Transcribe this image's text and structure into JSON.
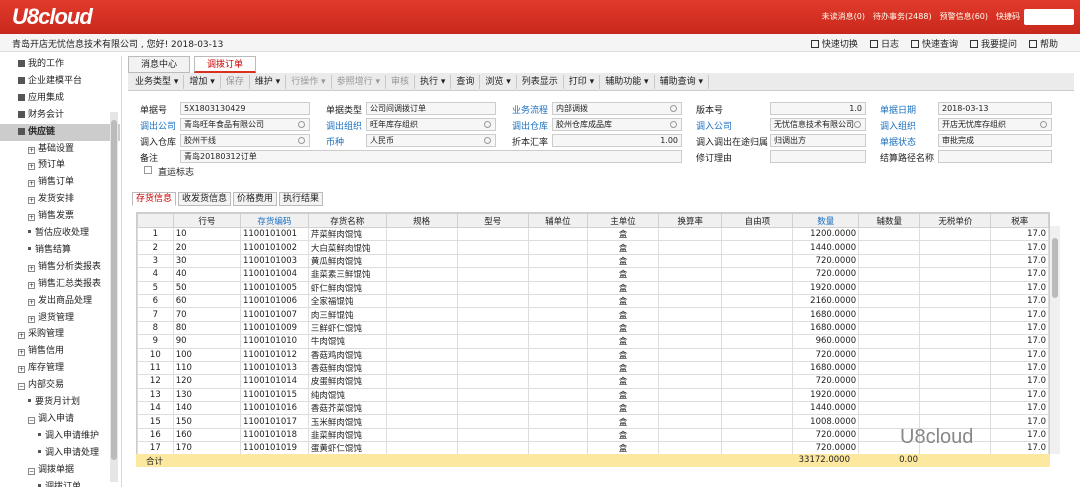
{
  "brand": {
    "logo": "U8cloud",
    "accent": "#d93020"
  },
  "top_links": [
    "未读消息(0)",
    "待办事务(2488)",
    "预警信息(60)",
    "快捷码"
  ],
  "welcome": "青岛开店无忧信息技术有限公司       , 您好! 2018-03-13",
  "quick_links": [
    "快速切换",
    "日志",
    "快速查询",
    "我要提问",
    "帮助"
  ],
  "sidebar": [
    {
      "label": "我的工作",
      "type": "root",
      "indent": 0
    },
    {
      "label": "企业建模平台",
      "type": "root",
      "indent": 0
    },
    {
      "label": "应用集成",
      "type": "root",
      "indent": 0
    },
    {
      "label": "财务会计",
      "type": "root",
      "indent": 0
    },
    {
      "label": "供应链",
      "type": "selected",
      "indent": 0
    },
    {
      "label": "基础设置",
      "type": "plus",
      "indent": 1
    },
    {
      "label": "预订单",
      "type": "plus",
      "indent": 1
    },
    {
      "label": "销售订单",
      "type": "plus",
      "indent": 1
    },
    {
      "label": "发货安排",
      "type": "plus",
      "indent": 1
    },
    {
      "label": "销售发票",
      "type": "plus",
      "indent": 1
    },
    {
      "label": "暂估应收处理",
      "type": "leaf",
      "indent": 1
    },
    {
      "label": "销售结算",
      "type": "leaf",
      "indent": 1
    },
    {
      "label": "销售分析类报表",
      "type": "plus",
      "indent": 1
    },
    {
      "label": "销售汇总类报表",
      "type": "plus",
      "indent": 1
    },
    {
      "label": "发出商品处理",
      "type": "plus",
      "indent": 1
    },
    {
      "label": "退货管理",
      "type": "plus",
      "indent": 1
    },
    {
      "label": "采购管理",
      "type": "plus",
      "indent": 0
    },
    {
      "label": "销售信用",
      "type": "plus",
      "indent": 0
    },
    {
      "label": "库存管理",
      "type": "plus",
      "indent": 0
    },
    {
      "label": "内部交易",
      "type": "minus",
      "indent": 0
    },
    {
      "label": "要货月计划",
      "type": "leaf",
      "indent": 1
    },
    {
      "label": "调入申请",
      "type": "minus",
      "indent": 1
    },
    {
      "label": "调入申请维护",
      "type": "leaf",
      "indent": 2
    },
    {
      "label": "调入申请处理",
      "type": "leaf",
      "indent": 2
    },
    {
      "label": "调拨单据",
      "type": "minus",
      "indent": 1
    },
    {
      "label": "调拨订单",
      "type": "leaf",
      "indent": 2
    }
  ],
  "tabs": [
    "消息中心",
    "调拨订单"
  ],
  "toolbar": [
    {
      "label": "业务类型 ▾",
      "enabled": true
    },
    {
      "label": "增加 ▾",
      "enabled": true
    },
    {
      "label": "保存",
      "enabled": false
    },
    {
      "label": "维护 ▾",
      "enabled": true
    },
    {
      "label": "行操作 ▾",
      "enabled": false
    },
    {
      "label": "参照增行 ▾",
      "enabled": false
    },
    {
      "label": "审核",
      "enabled": false
    },
    {
      "label": "执行 ▾",
      "enabled": true
    },
    {
      "label": "查询",
      "enabled": true
    },
    {
      "label": "浏览 ▾",
      "enabled": true
    },
    {
      "label": "列表显示",
      "enabled": true
    },
    {
      "label": "打印 ▾",
      "enabled": true
    },
    {
      "label": "辅助功能 ▾",
      "enabled": true
    },
    {
      "label": "辅助查询 ▾",
      "enabled": true
    }
  ],
  "form": {
    "单据号": "5X1803130429",
    "单据类型": "公司间调拨订单",
    "业务流程": "内部调拨",
    "版本号": "1.0",
    "单据日期": "2018-03-13",
    "调出公司": "青岛旺年食品有限公司",
    "调出组织": "旺年库存组织",
    "调出仓库": "胶州仓库成品库",
    "调入公司": "无忧信息技术有限公司",
    "调入组织": "开店无忧库存组织",
    "调入仓库": "胶州干线",
    "币种": "人民币",
    "折本汇率": "1.00",
    "调入调出在途归属": "归调出方",
    "单据状态": "审批完成",
    "备注": "青岛20180312订单",
    "修订理由": "",
    "结算路径名称": "",
    "直运标志": "直运标志"
  },
  "subtabs": [
    "存货信息",
    "收发货信息",
    "价格费用",
    "执行结果"
  ],
  "columns": [
    "行号",
    "存货编码",
    "存货名称",
    "规格",
    "型号",
    "辅单位",
    "主单位",
    "换算率",
    "自由项",
    "数量",
    "辅数量",
    "无税单价",
    "税率"
  ],
  "rows": [
    [
      "1",
      "10",
      "1100101001",
      "芹菜鲜肉馄饨",
      "盒",
      "1200.0000",
      "17.0"
    ],
    [
      "2",
      "20",
      "1100101002",
      "大白菜鲜肉馄饨",
      "盒",
      "1440.0000",
      "17.0"
    ],
    [
      "3",
      "30",
      "1100101003",
      "黄瓜鲜肉馄饨",
      "盒",
      "720.0000",
      "17.0"
    ],
    [
      "4",
      "40",
      "1100101004",
      "韭菜素三鲜馄饨",
      "盒",
      "720.0000",
      "17.0"
    ],
    [
      "5",
      "50",
      "1100101005",
      "虾仁鲜肉馄饨",
      "盒",
      "1920.0000",
      "17.0"
    ],
    [
      "6",
      "60",
      "1100101006",
      "全家福馄饨",
      "盒",
      "2160.0000",
      "17.0"
    ],
    [
      "7",
      "70",
      "1100101007",
      "肉三鲜馄饨",
      "盒",
      "1680.0000",
      "17.0"
    ],
    [
      "8",
      "80",
      "1100101009",
      "三鲜虾仁馄饨",
      "盒",
      "1680.0000",
      "17.0"
    ],
    [
      "9",
      "90",
      "1100101010",
      "牛肉馄饨",
      "盒",
      "960.0000",
      "17.0"
    ],
    [
      "10",
      "100",
      "1100101012",
      "香菇鸡肉馄饨",
      "盒",
      "720.0000",
      "17.0"
    ],
    [
      "11",
      "110",
      "1100101013",
      "香菇鲜肉馄饨",
      "盒",
      "1680.0000",
      "17.0"
    ],
    [
      "12",
      "120",
      "1100101014",
      "皮蛋鲜肉馄饨",
      "盒",
      "720.0000",
      "17.0"
    ],
    [
      "13",
      "130",
      "1100101015",
      "纯肉馄饨",
      "盒",
      "1920.0000",
      "17.0"
    ],
    [
      "14",
      "140",
      "1100101016",
      "香菇芥菜馄饨",
      "盒",
      "1440.0000",
      "17.0"
    ],
    [
      "15",
      "150",
      "1100101017",
      "玉米鲜肉馄饨",
      "盒",
      "1008.0000",
      "17.0"
    ],
    [
      "16",
      "160",
      "1100101018",
      "韭菜鲜肉馄饨",
      "盒",
      "720.0000",
      "17.0"
    ],
    [
      "17",
      "170",
      "1100101019",
      "蛋黄虾仁馄饨",
      "盒",
      "720.0000",
      "17.0"
    ]
  ],
  "total": {
    "label": "合计",
    "quantity": "33172.0000",
    "aux": "0.00"
  },
  "watermark": "U8cloud"
}
